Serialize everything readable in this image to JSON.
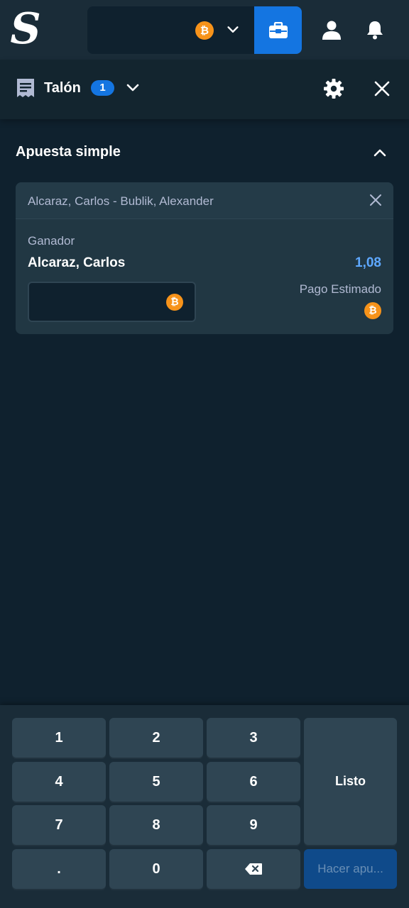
{
  "header": {
    "logo_text": "S",
    "currency_icon": "bitcoin-icon",
    "currency_symbol": "₿",
    "colors": {
      "background": "#1a2c38",
      "wallet_button": "#1475e1",
      "bitcoin": "#f7931a"
    }
  },
  "betslip": {
    "title": "Talón",
    "count": "1",
    "section_title": "Apuesta simple",
    "bet": {
      "event": "Alcaraz, Carlos - Bublik, Alexander",
      "market": "Ganador",
      "selection": "Alcaraz, Carlos",
      "odds": "1,08",
      "stake_value": "",
      "payout_label": "Pago Estimado",
      "currency_symbol": "₿"
    }
  },
  "keypad": {
    "keys": [
      "1",
      "2",
      "3",
      "4",
      "5",
      "6",
      "7",
      "8",
      "9",
      ".",
      "0"
    ],
    "done_label": "Listo",
    "place_bet_label": "Hacer apu..."
  }
}
